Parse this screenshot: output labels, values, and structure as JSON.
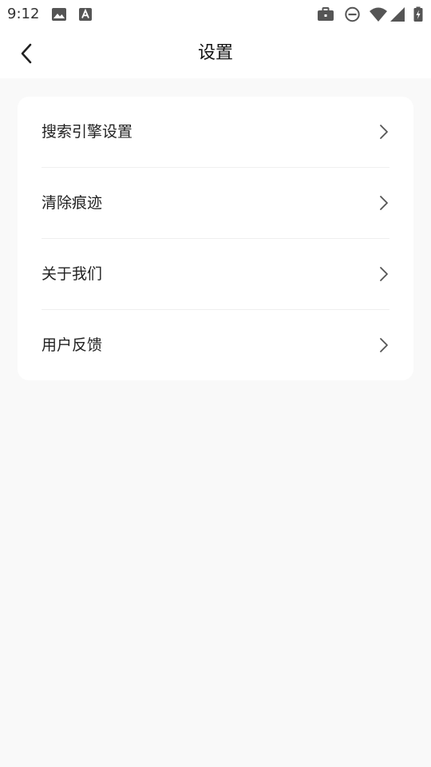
{
  "status_bar": {
    "time": "9:12",
    "icons": [
      "image-icon",
      "font-a-icon",
      "briefcase-icon",
      "do-not-disturb-icon",
      "wifi-icon",
      "cellular-icon",
      "battery-charging-icon"
    ]
  },
  "header": {
    "title": "设置",
    "back_icon": "chevron-left-icon"
  },
  "settings": {
    "items": [
      {
        "label": "搜索引擎设置",
        "icon": "chevron-right-icon"
      },
      {
        "label": "清除痕迹",
        "icon": "chevron-right-icon"
      },
      {
        "label": "关于我们",
        "icon": "chevron-right-icon"
      },
      {
        "label": "用户反馈",
        "icon": "chevron-right-icon"
      }
    ]
  },
  "colors": {
    "background": "#f9f9f9",
    "surface": "#ffffff",
    "text": "#222222",
    "chevron": "#555555",
    "divider": "#efefef"
  }
}
